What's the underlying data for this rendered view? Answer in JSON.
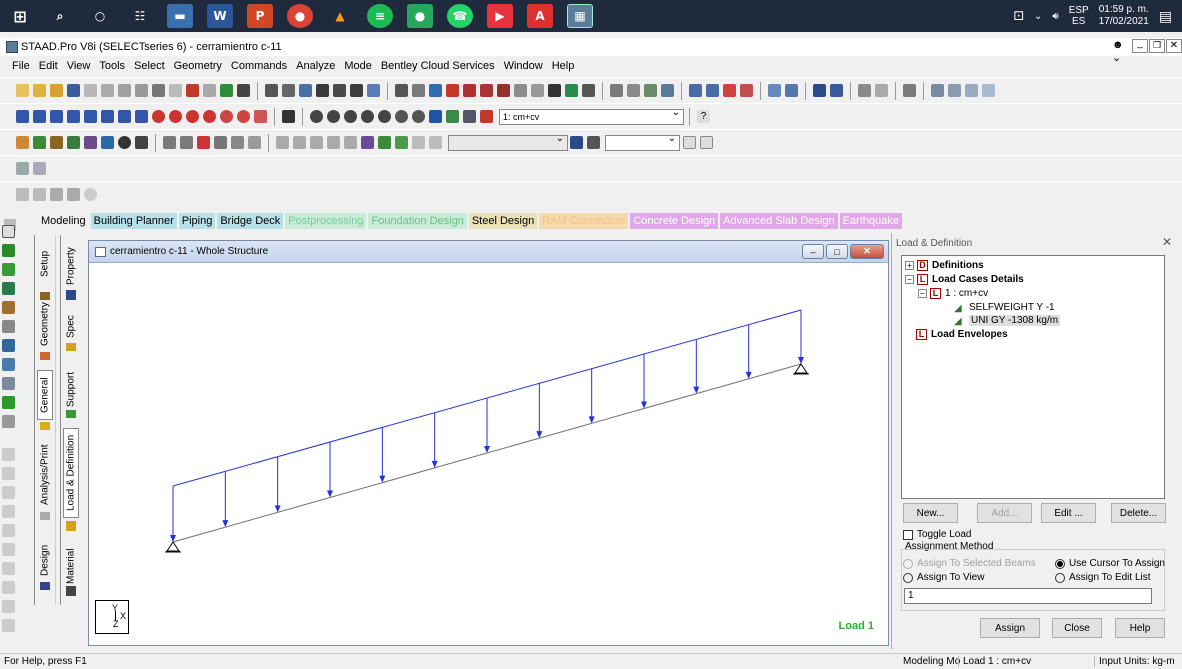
{
  "taskbar": {
    "lang": "ESP",
    "lang_sub": "ES",
    "time": "01:59 p. m.",
    "date": "17/02/2021"
  },
  "window": {
    "title": "STAAD.Pro V8i (SELECTseries 6) - cerramientro c-11"
  },
  "menu": [
    "File",
    "Edit",
    "View",
    "Tools",
    "Select",
    "Geometry",
    "Commands",
    "Analyze",
    "Mode",
    "Bentley Cloud Services",
    "Window",
    "Help"
  ],
  "toolbar": {
    "load_combo": "1: cm+cv"
  },
  "tabs": [
    {
      "label": "Modeling",
      "bg": "transparent",
      "fg": "#000000"
    },
    {
      "label": "Building Planner",
      "bg": "#b8e0e8",
      "fg": "#000000"
    },
    {
      "label": "Piping",
      "bg": "#b8e0e8",
      "fg": "#000000"
    },
    {
      "label": "Bridge Deck",
      "bg": "#b8e0e8",
      "fg": "#000000"
    },
    {
      "label": "Postprocessing",
      "bg": "#c9ecd9",
      "fg": "#7ec99a"
    },
    {
      "label": "Foundation Design",
      "bg": "#c9ecd9",
      "fg": "#6cbf88"
    },
    {
      "label": "Steel Design",
      "bg": "#e9e0b8",
      "fg": "#000000"
    },
    {
      "label": "RAM Connection",
      "bg": "#f7d9b0",
      "fg": "#f1c27f"
    },
    {
      "label": "Concrete Design",
      "bg": "#e0a8e8",
      "fg": "#ffffff"
    },
    {
      "label": "Advanced Slab Design",
      "bg": "#e0a8e8",
      "fg": "#ffffff"
    },
    {
      "label": "Earthquake",
      "bg": "#e0a8e8",
      "fg": "#ffffff"
    }
  ],
  "sidetabs": {
    "setup": "Setup",
    "geometry": "Geometry",
    "general": "General",
    "analysis": "Analysis/Print",
    "design": "Design",
    "property": "Property",
    "spec": "Spec",
    "support": "Support",
    "load": "Load & Definition",
    "material": "Material"
  },
  "viewport": {
    "title": "cerramientro c-11 - Whole Structure",
    "load_label": "Load 1",
    "axis_y": "Y",
    "axis_x": "X",
    "axis_z": "Z"
  },
  "panel": {
    "title": "Load & Definition",
    "tree": {
      "definitions": "Definitions",
      "load_cases": "Load Cases Details",
      "case1": "1 : cm+cv",
      "selfweight": "SELFWEIGHT Y -1",
      "uni": "UNI GY -1308 kg/m",
      "envelopes": "Load Envelopes"
    },
    "buttons": {
      "new": "New...",
      "add": "Add...",
      "edit": "Edit ...",
      "delete": "Delete...",
      "assign": "Assign",
      "close": "Close",
      "help": "Help"
    },
    "toggle_load": "Toggle Load",
    "assignment_method": "Assignment Method",
    "opt_selected_beams": "Assign To Selected Beams",
    "opt_cursor": "Use Cursor To Assign",
    "opt_view": "Assign To View",
    "opt_edit_list": "Assign To Edit List",
    "edit_value": "1"
  },
  "status": {
    "help": "For Help, press F1",
    "mode": "Modeling Mo",
    "load": "Load 1 : cm+cv",
    "units": "Input Units:  kg-m"
  }
}
